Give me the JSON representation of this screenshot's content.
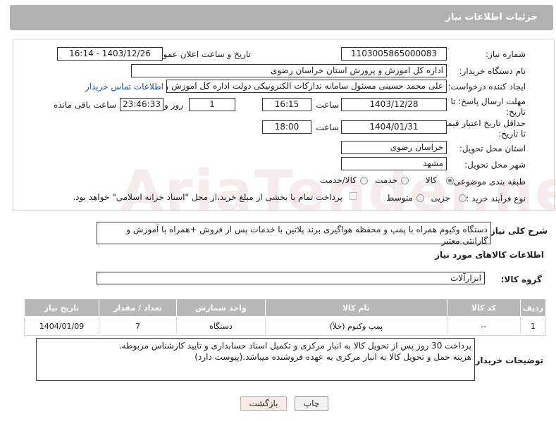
{
  "header": {
    "title": "جزئیات اطلاعات نیاز"
  },
  "form": {
    "need_number_label": "شماره نیاز:",
    "need_number": "1103005865000083",
    "announce_label": "تاریخ و ساعت اعلان عمومی:",
    "announce_value": "1403/12/26 - 16:14",
    "buyer_org_label": "نام دستگاه خریدار:",
    "buyer_org": "اداره کل اموزش و پرورش استان خراسان رضوی",
    "creator_label": "ایجاد کننده درخواست:",
    "creator": "علی محمد حسینی مسئول سامانه تدارکات الکترونیکی دولت اداره کل اموزش و",
    "contact_link": "اطلاعات تماس خریدار",
    "reply_deadline_label": "مهلت ارسال پاسخ: تا تاریخ:",
    "reply_date": "1403/12/28",
    "time_label": "ساعت",
    "reply_time": "16:15",
    "days_value": "1",
    "days_label": "روز و",
    "remaining_value": "23:46:33",
    "remaining_label": "ساعت باقی مانده",
    "price_validity_label": "حداقل تاریخ اعتبار قیمت: تا تاریخ:",
    "price_date": "1404/01/31",
    "price_time": "18:00",
    "province_label": "استان محل تحویل:",
    "province": "خراسان رضوی",
    "city_label": "شهر محل تحویل:",
    "city": "مشهد",
    "category_label": "طبقه بندی موضوعی:",
    "category_options": [
      "کالا",
      "خدمت",
      "کالا/خدمت"
    ],
    "purchase_type_label": "نوع فرآیند خرید :",
    "purchase_options": [
      "جزیی",
      "متوسط"
    ],
    "payment_note": "پرداخت تمام یا بخشی از مبلغ خرید،از محل \"اسناد خزانه اسلامی\" خواهد بود."
  },
  "description": {
    "label": "شرح کلی نیاز:",
    "text": "دستگاه وکیوم همراه با پمپ و محفظه هواگیری برند پلاتین با خدمات پس از فروش +همراه با آموزش و گارانتی معتبر"
  },
  "goods": {
    "section_title": "اطلاعات کالاهای مورد نیاز",
    "group_label": "گروه کالا:",
    "group_value": "ابزارآلات",
    "columns": [
      "ردیف",
      "کد کالا",
      "نام کالا",
      "واحد شمارش",
      "تعداد / مقدار",
      "تاریخ نیاز"
    ],
    "rows": [
      [
        "1",
        "--",
        "پمپ وکیوم (خلأ)",
        "دستگاه",
        "7",
        "1404/01/09"
      ]
    ]
  },
  "buyer_notes": {
    "label": "توضیحات خریدار:",
    "line1": "پرداخت 30 روز پس از تحویل کالا به انبار مرکزی و تکمیل اسناد حسابداری و تایید کارشناس مربوطه.",
    "line2": "هزینه حمل و تحویل کالا به انبار مرکزی به عهده فروشنده میباشد.(پیوست دارد)"
  },
  "buttons": {
    "print": "چاپ",
    "back": "بازگشت"
  },
  "watermark": "AriaTender.neT"
}
